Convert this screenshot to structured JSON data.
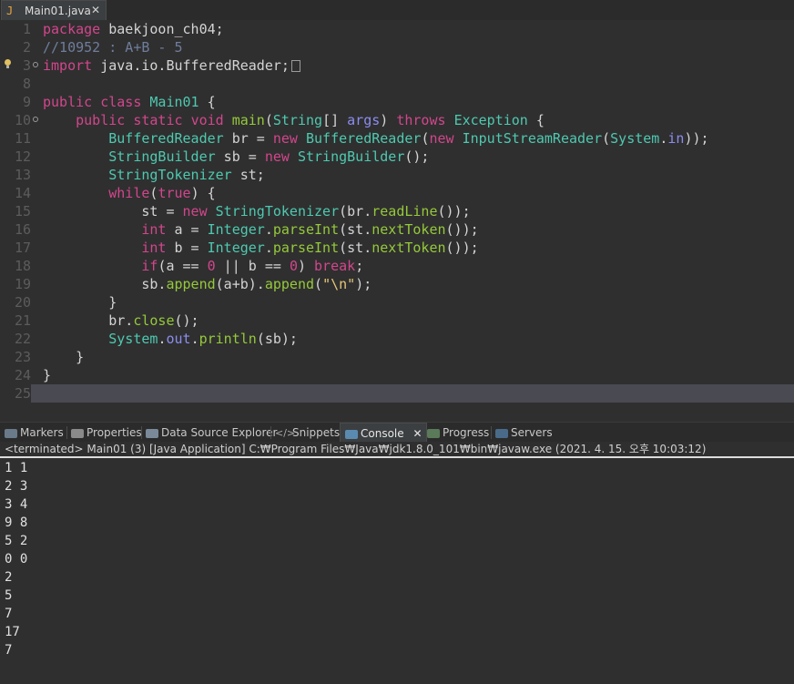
{
  "editor_tab": {
    "label": "Main01.java",
    "icon": "java-file-icon",
    "close": "✕"
  },
  "line_numbers": [
    "1",
    "2",
    "3",
    "8",
    "9",
    "10",
    "11",
    "12",
    "13",
    "14",
    "15",
    "16",
    "17",
    "18",
    "19",
    "20",
    "21",
    "22",
    "23",
    "24",
    "25"
  ],
  "code": {
    "l1": {
      "kw": "package",
      "rest": " baekjoon_ch04;"
    },
    "l2": {
      "comment": "//10952 : A+B - 5"
    },
    "l3": {
      "kw": "import",
      "rest": " java.io.BufferedReader;"
    },
    "l9": {
      "kw1": "public",
      "kw2": "class",
      "name": "Main01",
      "rest": " {"
    },
    "l10": {
      "kw1": "public",
      "kw2": "static",
      "kw3": "void",
      "method": "main",
      "p1": "(",
      "type": "String",
      "p2": "[] ",
      "param": "args",
      "p3": ") ",
      "kw4": "throws",
      "exc": "Exception",
      "rest": " {"
    },
    "l11": {
      "type1": "BufferedReader",
      "a": " br = ",
      "kw": "new",
      "b": " ",
      "type2": "BufferedReader",
      "c": "(",
      "kw2": "new",
      "d": " ",
      "type3": "InputStreamReader",
      "e": "(",
      "type4": "System",
      "f": ".",
      "field": "in",
      "g": "));"
    },
    "l12": {
      "type1": "StringBuilder",
      "a": " sb = ",
      "kw": "new",
      "b": " ",
      "type2": "StringBuilder",
      "c": "();"
    },
    "l13": {
      "type": "StringTokenizer",
      "rest": " st;"
    },
    "l14": {
      "kw": "while",
      "a": "(",
      "kw2": "true",
      "rest": ") {"
    },
    "l15": {
      "a": "st = ",
      "kw": "new",
      "b": " ",
      "type": "StringTokenizer",
      "c": "(br.",
      "m": "readLine",
      "d": "());"
    },
    "l16": {
      "kw": "int",
      "a": " a = ",
      "type": "Integer",
      "b": ".",
      "m1": "parseInt",
      "c": "(st.",
      "m2": "nextToken",
      "d": "());"
    },
    "l17": {
      "kw": "int",
      "a": " b = ",
      "type": "Integer",
      "b": ".",
      "m1": "parseInt",
      "c": "(st.",
      "m2": "nextToken",
      "d": "());"
    },
    "l18": {
      "kw": "if",
      "a": "(a == ",
      "n1": "0",
      "b": " || b == ",
      "n2": "0",
      "c": ") ",
      "kw2": "break",
      "d": ";"
    },
    "l19": {
      "a": "sb.",
      "m1": "append",
      "b": "(a+b).",
      "m2": "append",
      "c": "(",
      "str": "\"\\n\"",
      "d": ");"
    },
    "l20": {
      "rest": "}"
    },
    "l21": {
      "a": "br.",
      "m": "close",
      "b": "();"
    },
    "l22": {
      "type": "System",
      "a": ".",
      "field": "out",
      "b": ".",
      "m": "println",
      "c": "(sb);"
    },
    "l23": {
      "rest": "}"
    },
    "l24": {
      "rest": "}"
    }
  },
  "panel_tabs": [
    {
      "label": "Markers",
      "icon": "markers-icon"
    },
    {
      "label": "Properties",
      "icon": "properties-icon"
    },
    {
      "label": "Data Source Explorer",
      "icon": "data-source-icon"
    },
    {
      "label": "Snippets",
      "icon": "snippets-icon"
    },
    {
      "label": "Console",
      "icon": "console-icon",
      "close": "✕"
    },
    {
      "label": "Progress",
      "icon": "progress-icon"
    },
    {
      "label": "Servers",
      "icon": "servers-icon"
    }
  ],
  "status_line": "<terminated> Main01 (3) [Java Application] C:₩Program Files₩Java₩jdk1.8.0_101₩bin₩javaw.exe (2021. 4. 15. 오후 10:03:12)",
  "console_output": [
    "1 1",
    "2 3",
    "3 4",
    "9 8",
    "5 2",
    "0 0",
    "2",
    "5",
    "7",
    "17",
    "7"
  ],
  "colors": {
    "keyword": "#d2468c",
    "type": "#4ec9b0",
    "method": "#95c93a",
    "field": "#8c8cf0",
    "comment": "#6f7d9c",
    "string": "#e6c87a",
    "background": "#2f2f2f",
    "current_line": "#4a4a52"
  }
}
